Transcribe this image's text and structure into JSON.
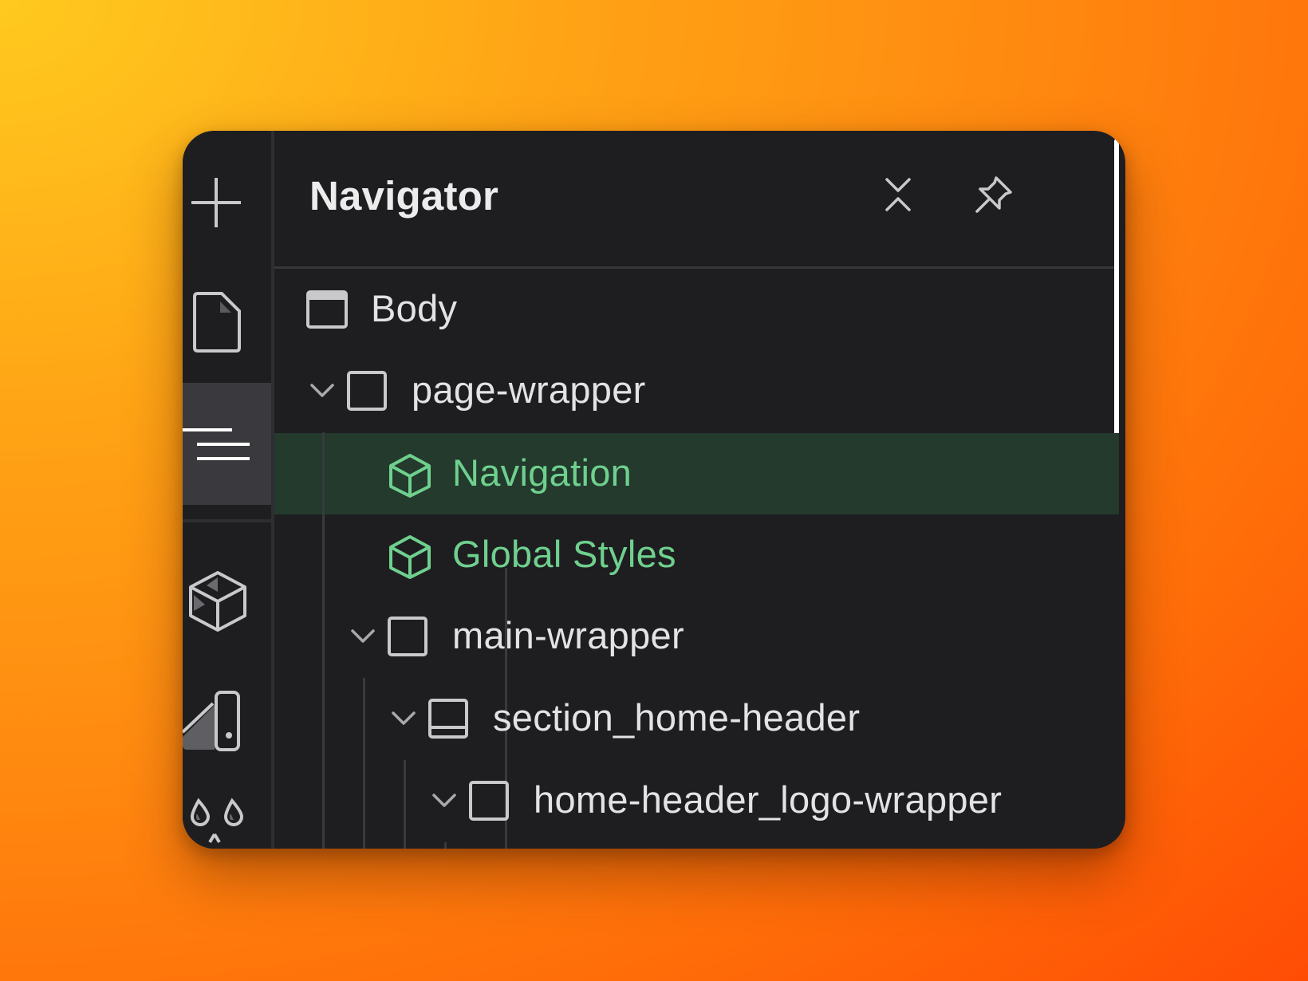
{
  "window": {
    "title": "Navigator"
  },
  "rail": {
    "items": [
      {
        "icon": "plus-icon",
        "active": false
      },
      {
        "icon": "page-icon",
        "active": false
      },
      {
        "icon": "navigator-icon",
        "active": true
      },
      {
        "icon": "components-icon",
        "active": false
      },
      {
        "icon": "style-selectors-icon",
        "active": false
      },
      {
        "icon": "color-swatches-icon",
        "active": false
      }
    ]
  },
  "header": {
    "collapse_icon": "collapse-all-icon",
    "pin_icon": "pin-icon"
  },
  "tree": {
    "nodes": [
      {
        "label": "Body",
        "icon": "body-icon",
        "depth": 0,
        "expandable": false,
        "component": false
      },
      {
        "label": "page-wrapper",
        "icon": "div-block-icon",
        "depth": 0,
        "expandable": true,
        "component": false
      },
      {
        "label": "Navigation",
        "icon": "component-cube-icon",
        "depth": 1,
        "expandable": false,
        "component": true,
        "selected": true
      },
      {
        "label": "Global Styles",
        "icon": "component-cube-icon",
        "depth": 1,
        "expandable": false,
        "component": true
      },
      {
        "label": "main-wrapper",
        "icon": "div-block-icon",
        "depth": 1,
        "expandable": true,
        "component": false
      },
      {
        "label": "section_home-header",
        "icon": "section-icon",
        "depth": 2,
        "expandable": true,
        "component": false
      },
      {
        "label": "home-header_logo-wrapper",
        "icon": "div-block-icon",
        "depth": 3,
        "expandable": true,
        "component": false
      }
    ]
  },
  "colors": {
    "background": "#1e1e21",
    "selected_row": "#233a2d",
    "component_text": "#6fd08e",
    "text": "#e3e3e5"
  }
}
